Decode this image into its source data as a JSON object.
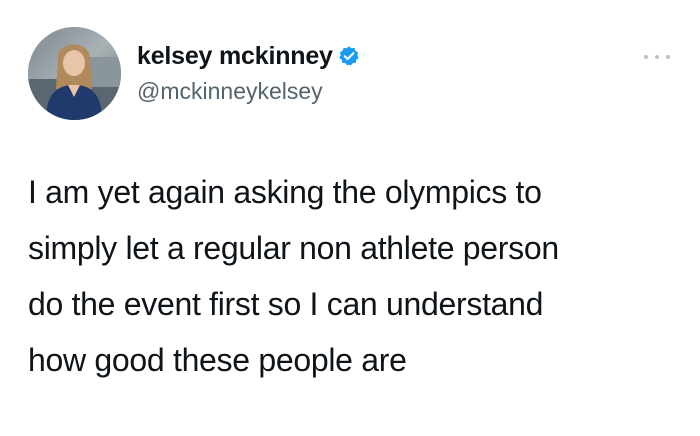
{
  "author": {
    "display_name": "kelsey mckinney",
    "handle": "@mckinneykelsey",
    "verified": true
  },
  "tweet": {
    "lines": [
      "I am yet again asking the olympics to",
      "simply let a regular non athlete person",
      "do the event first so I can understand",
      "how good these people are"
    ]
  },
  "icons": {
    "verified": "verified-badge-icon",
    "more": "more-horizontal-icon"
  },
  "colors": {
    "text": "#0f1419",
    "secondary": "#53646f",
    "verified_blue": "#1d9bf0"
  }
}
